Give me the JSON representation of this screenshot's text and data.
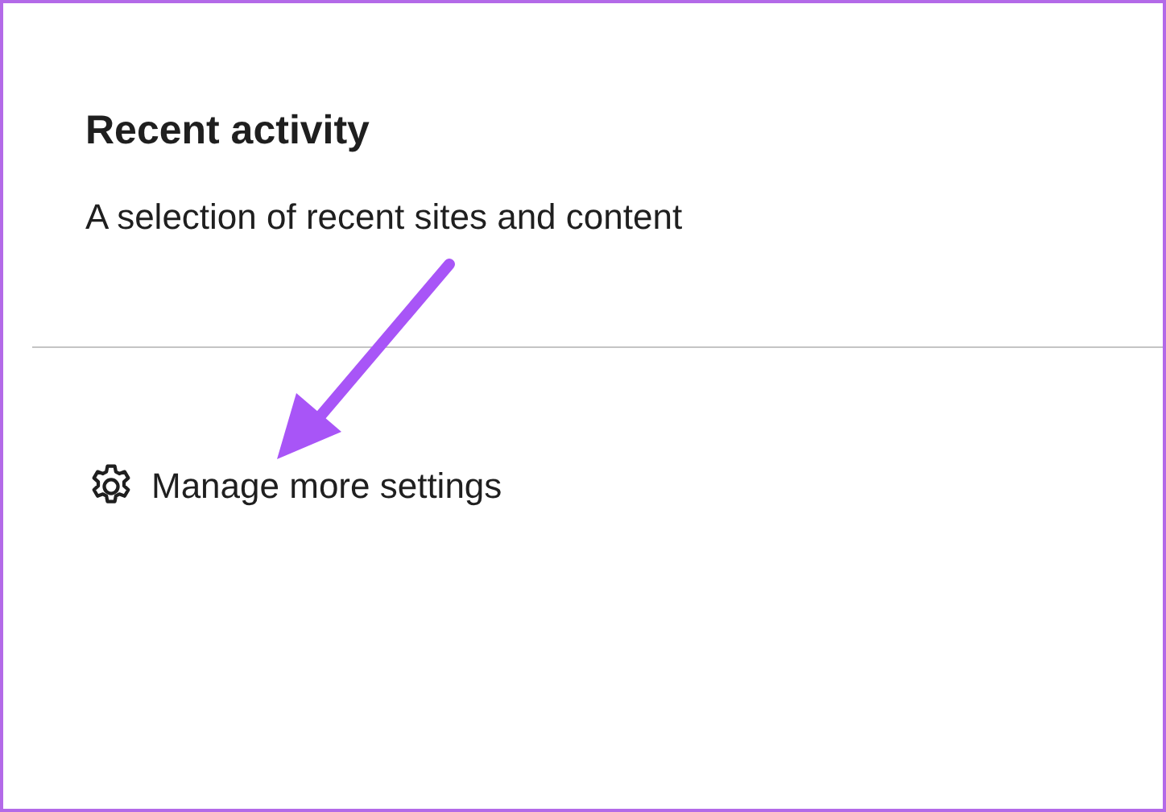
{
  "section": {
    "title": "Recent activity",
    "description": "A selection of recent sites and content"
  },
  "link": {
    "label": "Manage more settings"
  }
}
